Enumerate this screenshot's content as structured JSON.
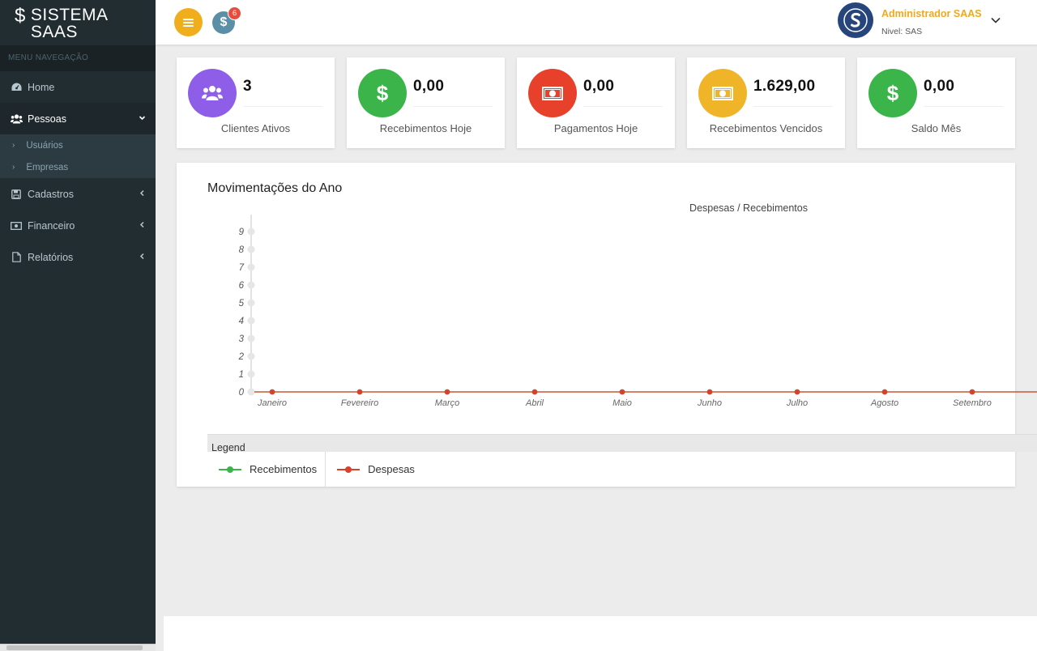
{
  "brand": {
    "symbol": "$",
    "name": "SISTEMA SAAS"
  },
  "sidebar": {
    "menu_header": "MENU NAVEGAÇÃO",
    "items": [
      {
        "label": "Home",
        "icon": "dashboard-icon"
      },
      {
        "label": "Pessoas",
        "icon": "users-icon",
        "expanded": true
      },
      {
        "label": "Cadastros",
        "icon": "save-icon"
      },
      {
        "label": "Financeiro",
        "icon": "money-icon"
      },
      {
        "label": "Relatórios",
        "icon": "file-icon"
      }
    ],
    "pessoas_sub": [
      {
        "label": "Usuários"
      },
      {
        "label": "Empresas"
      }
    ]
  },
  "topbar": {
    "notification_count": "6",
    "notification_symbol": "$",
    "user_name": "Administrador SAAS",
    "user_level": "Nivel: SAS"
  },
  "cards": [
    {
      "value": "3",
      "label": "Clientes Ativos",
      "color": "#8e5ee8",
      "icon": "users-icon"
    },
    {
      "value": "0,00",
      "label": "Recebimentos Hoje",
      "color": "#3bb54a",
      "icon": "dollar-icon"
    },
    {
      "value": "0,00",
      "label": "Pagamentos Hoje",
      "color": "#e8412b",
      "icon": "money-bill-icon"
    },
    {
      "value": "1.629,00",
      "label": "Recebimentos Vencidos",
      "color": "#f0b429",
      "icon": "money-bill-icon"
    },
    {
      "value": "0,00",
      "label": "Saldo Mês",
      "color": "#3bb54a",
      "icon": "dollar-icon"
    }
  ],
  "panel": {
    "title": "Movimentações do Ano"
  },
  "chart_data": {
    "type": "line",
    "title": "Despesas / Recebimentos",
    "categories": [
      "Janeiro",
      "Fevereiro",
      "Março",
      "Abril",
      "Maio",
      "Junho",
      "Julho",
      "Agosto",
      "Setembro"
    ],
    "ylim": [
      0,
      9
    ],
    "yticks": [
      "0",
      "1",
      "2",
      "3",
      "4",
      "5",
      "6",
      "7",
      "8",
      "9"
    ],
    "series": [
      {
        "name": "Recebimentos",
        "color": "#3bb54a",
        "values": [
          0,
          0,
          0,
          0,
          0,
          0,
          0,
          0,
          0
        ]
      },
      {
        "name": "Despesas",
        "color": "#d9412b",
        "values": [
          0,
          0,
          0,
          0,
          0,
          0,
          0,
          0,
          0
        ]
      }
    ],
    "legend_title": "Legend",
    "legend_position": "bottom-left"
  }
}
